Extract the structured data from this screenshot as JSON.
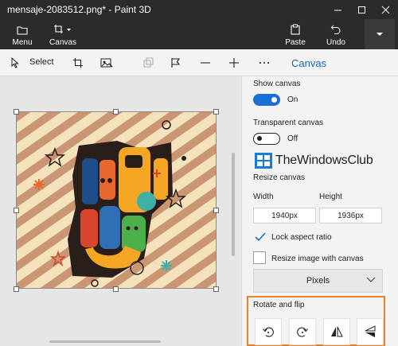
{
  "window": {
    "title": "mensaje-2083512.png* - Paint 3D"
  },
  "command_bar": {
    "menu_label": "Menu",
    "canvas_label": "Canvas",
    "paste_label": "Paste",
    "undo_label": "Undo"
  },
  "toolbar": {
    "select_label": "Select",
    "panel_title": "Canvas"
  },
  "panel": {
    "show_canvas_label": "Show canvas",
    "show_canvas_state": "On",
    "show_canvas_on": true,
    "transparent_canvas_label": "Transparent canvas",
    "transparent_canvas_state": "Off",
    "transparent_canvas_on": false,
    "watermark": "TheWindowsClub",
    "resize_canvas_label": "Resize canvas",
    "width_label": "Width",
    "height_label": "Height",
    "width_value": "1940px",
    "height_value": "1936px",
    "lock_aspect_label": "Lock aspect ratio",
    "lock_aspect_checked": true,
    "resize_with_canvas_label": "Resize image with canvas",
    "resize_with_canvas_checked": false,
    "units_value": "Pixels",
    "rotate_flip_label": "Rotate and flip"
  },
  "colors": {
    "accent": "#1a6fd1",
    "title_bar": "#2b2b2b",
    "highlight": "#e8822a",
    "art_background": "#f3e2bc",
    "art_stripe": "#c99572"
  }
}
